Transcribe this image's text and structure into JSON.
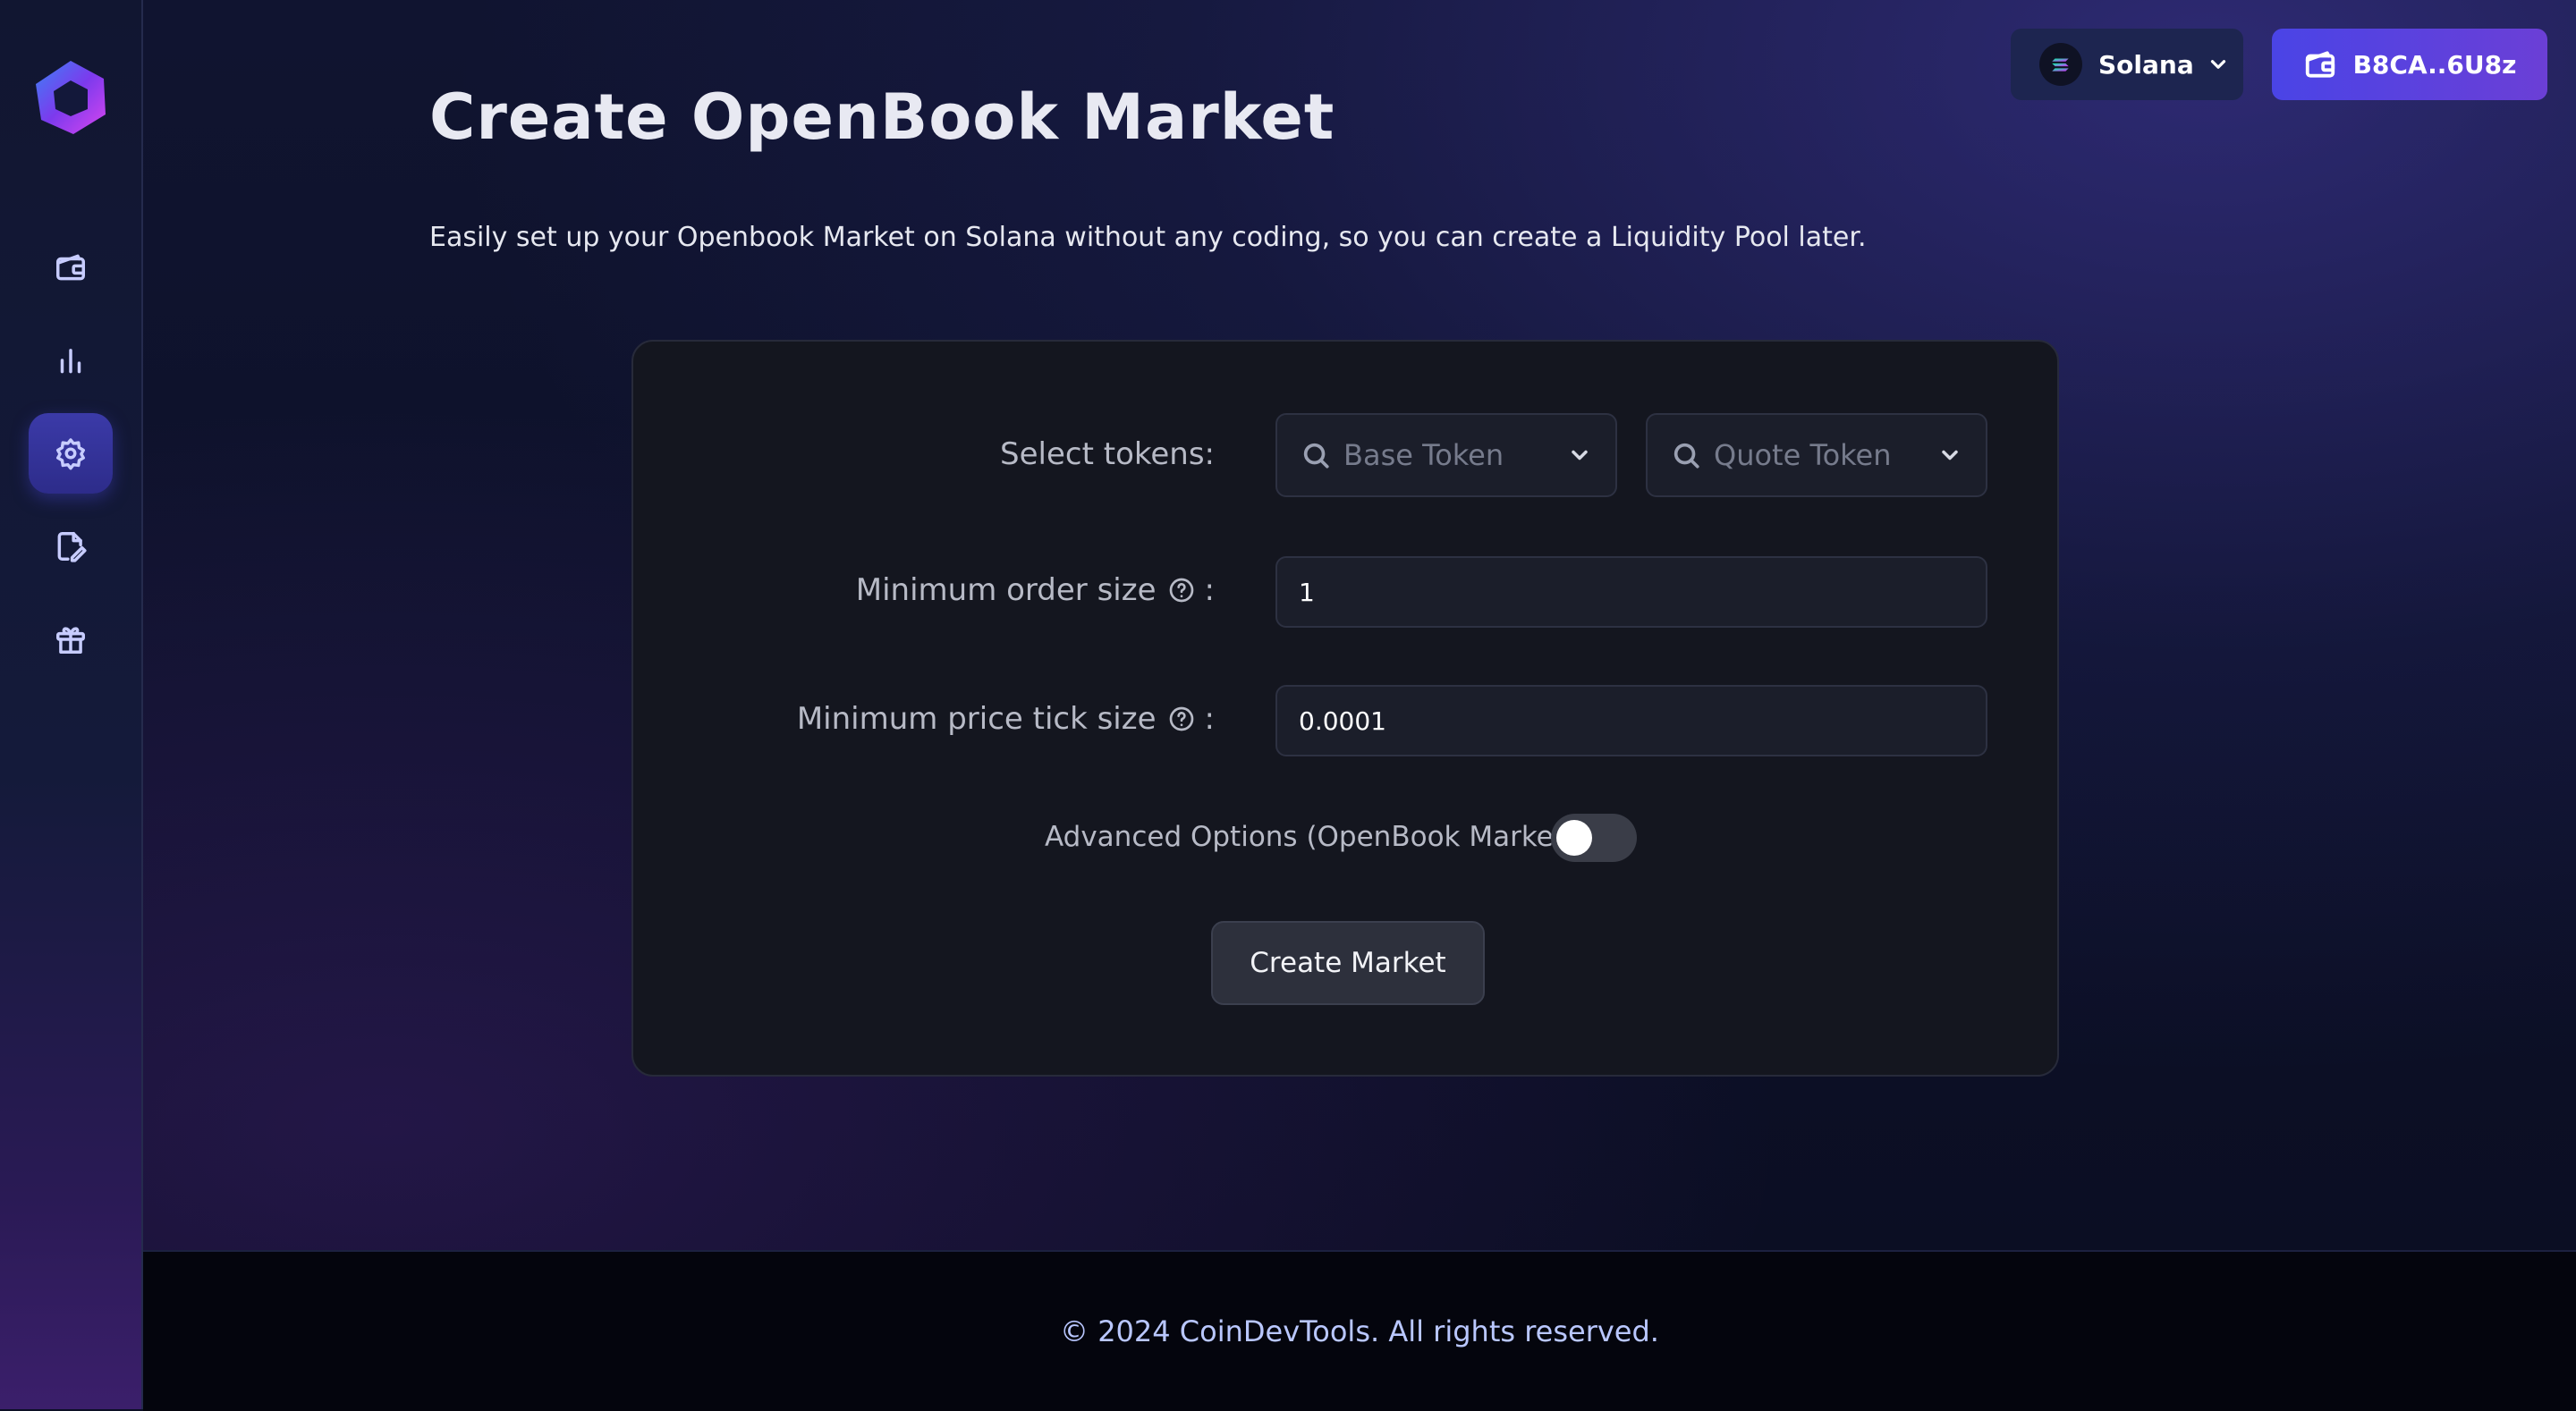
{
  "header": {
    "network": {
      "label": "Solana",
      "icon": "solana-icon"
    },
    "wallet": {
      "label": "B8CA..6U8z",
      "icon": "wallet-icon"
    }
  },
  "sidebar": {
    "items": [
      {
        "name": "wallet",
        "icon": "wallet-icon",
        "active": false
      },
      {
        "name": "chart",
        "icon": "bar-chart-icon",
        "active": false
      },
      {
        "name": "settings",
        "icon": "gear-icon",
        "active": true
      },
      {
        "name": "edit-document",
        "icon": "document-edit-icon",
        "active": false
      },
      {
        "name": "gift",
        "icon": "gift-icon",
        "active": false
      }
    ]
  },
  "page": {
    "title": "Create OpenBook Market",
    "subtitle": "Easily set up your Openbook Market on Solana without any coding, so you can create a Liquidity Pool later."
  },
  "form": {
    "select_tokens_label": "Select tokens:",
    "base_token_placeholder": "Base Token",
    "quote_token_placeholder": "Quote Token",
    "min_order_size_label": "Minimum order size",
    "min_order_size_value": "1",
    "min_tick_size_label": "Minimum price tick size",
    "min_tick_size_value": "0.0001",
    "colon": ":",
    "advanced_options_label": "Advanced Options (OpenBook Market)",
    "advanced_options_enabled": false,
    "submit_label": "Create Market"
  },
  "footer": {
    "text": "© 2024 CoinDevTools. All rights reserved."
  },
  "colors": {
    "accent": "#4a44e6",
    "background": "#0c0f25",
    "card": "#14161f"
  }
}
